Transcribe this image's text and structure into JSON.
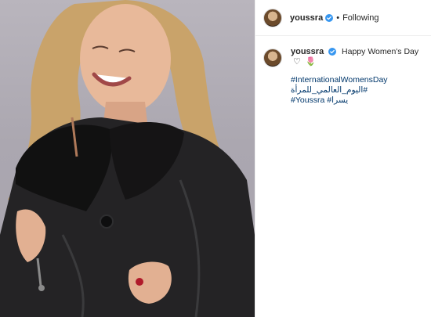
{
  "post": {
    "author": {
      "username": "youssra",
      "verified": true
    },
    "header": {
      "separator": "•",
      "follow_status": "Following"
    },
    "caption": {
      "text": "Happy Women's Day",
      "emojis": [
        "♡",
        "🌷"
      ],
      "hashtags": [
        "#InternationalWomensDay",
        "#اليوم_العالمي_للمرأة",
        "#Youssra #يسرا"
      ]
    },
    "colors": {
      "hashtag": "#00376b",
      "verified": "#3897f0",
      "divider": "#efefef",
      "text": "#262626"
    }
  }
}
